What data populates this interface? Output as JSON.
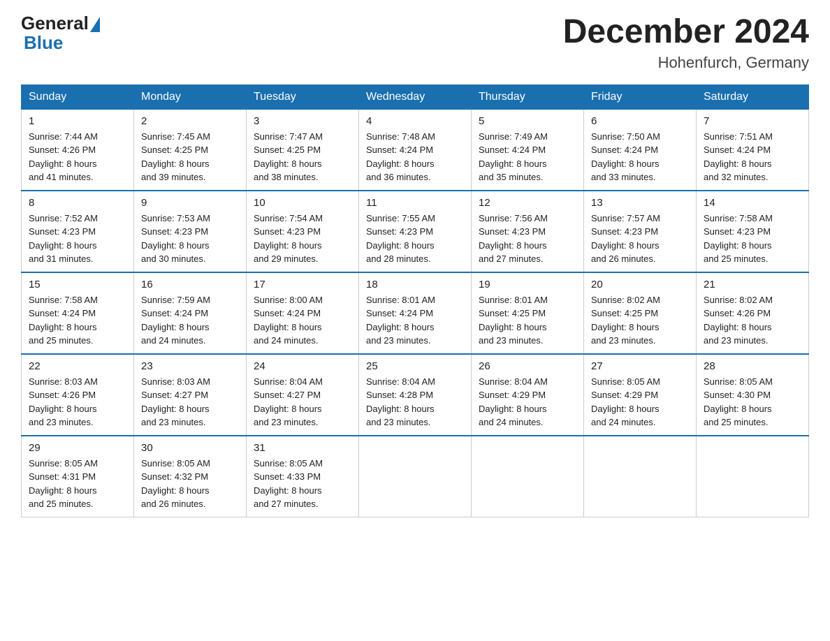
{
  "header": {
    "logo": {
      "general": "General",
      "blue": "Blue"
    },
    "title": "December 2024",
    "location": "Hohenfurch, Germany"
  },
  "weekdays": [
    "Sunday",
    "Monday",
    "Tuesday",
    "Wednesday",
    "Thursday",
    "Friday",
    "Saturday"
  ],
  "weeks": [
    [
      {
        "day": "1",
        "sunrise": "7:44 AM",
        "sunset": "4:26 PM",
        "daylight": "8 hours and 41 minutes."
      },
      {
        "day": "2",
        "sunrise": "7:45 AM",
        "sunset": "4:25 PM",
        "daylight": "8 hours and 39 minutes."
      },
      {
        "day": "3",
        "sunrise": "7:47 AM",
        "sunset": "4:25 PM",
        "daylight": "8 hours and 38 minutes."
      },
      {
        "day": "4",
        "sunrise": "7:48 AM",
        "sunset": "4:24 PM",
        "daylight": "8 hours and 36 minutes."
      },
      {
        "day": "5",
        "sunrise": "7:49 AM",
        "sunset": "4:24 PM",
        "daylight": "8 hours and 35 minutes."
      },
      {
        "day": "6",
        "sunrise": "7:50 AM",
        "sunset": "4:24 PM",
        "daylight": "8 hours and 33 minutes."
      },
      {
        "day": "7",
        "sunrise": "7:51 AM",
        "sunset": "4:24 PM",
        "daylight": "8 hours and 32 minutes."
      }
    ],
    [
      {
        "day": "8",
        "sunrise": "7:52 AM",
        "sunset": "4:23 PM",
        "daylight": "8 hours and 31 minutes."
      },
      {
        "day": "9",
        "sunrise": "7:53 AM",
        "sunset": "4:23 PM",
        "daylight": "8 hours and 30 minutes."
      },
      {
        "day": "10",
        "sunrise": "7:54 AM",
        "sunset": "4:23 PM",
        "daylight": "8 hours and 29 minutes."
      },
      {
        "day": "11",
        "sunrise": "7:55 AM",
        "sunset": "4:23 PM",
        "daylight": "8 hours and 28 minutes."
      },
      {
        "day": "12",
        "sunrise": "7:56 AM",
        "sunset": "4:23 PM",
        "daylight": "8 hours and 27 minutes."
      },
      {
        "day": "13",
        "sunrise": "7:57 AM",
        "sunset": "4:23 PM",
        "daylight": "8 hours and 26 minutes."
      },
      {
        "day": "14",
        "sunrise": "7:58 AM",
        "sunset": "4:23 PM",
        "daylight": "8 hours and 25 minutes."
      }
    ],
    [
      {
        "day": "15",
        "sunrise": "7:58 AM",
        "sunset": "4:24 PM",
        "daylight": "8 hours and 25 minutes."
      },
      {
        "day": "16",
        "sunrise": "7:59 AM",
        "sunset": "4:24 PM",
        "daylight": "8 hours and 24 minutes."
      },
      {
        "day": "17",
        "sunrise": "8:00 AM",
        "sunset": "4:24 PM",
        "daylight": "8 hours and 24 minutes."
      },
      {
        "day": "18",
        "sunrise": "8:01 AM",
        "sunset": "4:24 PM",
        "daylight": "8 hours and 23 minutes."
      },
      {
        "day": "19",
        "sunrise": "8:01 AM",
        "sunset": "4:25 PM",
        "daylight": "8 hours and 23 minutes."
      },
      {
        "day": "20",
        "sunrise": "8:02 AM",
        "sunset": "4:25 PM",
        "daylight": "8 hours and 23 minutes."
      },
      {
        "day": "21",
        "sunrise": "8:02 AM",
        "sunset": "4:26 PM",
        "daylight": "8 hours and 23 minutes."
      }
    ],
    [
      {
        "day": "22",
        "sunrise": "8:03 AM",
        "sunset": "4:26 PM",
        "daylight": "8 hours and 23 minutes."
      },
      {
        "day": "23",
        "sunrise": "8:03 AM",
        "sunset": "4:27 PM",
        "daylight": "8 hours and 23 minutes."
      },
      {
        "day": "24",
        "sunrise": "8:04 AM",
        "sunset": "4:27 PM",
        "daylight": "8 hours and 23 minutes."
      },
      {
        "day": "25",
        "sunrise": "8:04 AM",
        "sunset": "4:28 PM",
        "daylight": "8 hours and 23 minutes."
      },
      {
        "day": "26",
        "sunrise": "8:04 AM",
        "sunset": "4:29 PM",
        "daylight": "8 hours and 24 minutes."
      },
      {
        "day": "27",
        "sunrise": "8:05 AM",
        "sunset": "4:29 PM",
        "daylight": "8 hours and 24 minutes."
      },
      {
        "day": "28",
        "sunrise": "8:05 AM",
        "sunset": "4:30 PM",
        "daylight": "8 hours and 25 minutes."
      }
    ],
    [
      {
        "day": "29",
        "sunrise": "8:05 AM",
        "sunset": "4:31 PM",
        "daylight": "8 hours and 25 minutes."
      },
      {
        "day": "30",
        "sunrise": "8:05 AM",
        "sunset": "4:32 PM",
        "daylight": "8 hours and 26 minutes."
      },
      {
        "day": "31",
        "sunrise": "8:05 AM",
        "sunset": "4:33 PM",
        "daylight": "8 hours and 27 minutes."
      },
      null,
      null,
      null,
      null
    ]
  ],
  "labels": {
    "sunrise": "Sunrise:",
    "sunset": "Sunset:",
    "daylight": "Daylight:"
  }
}
